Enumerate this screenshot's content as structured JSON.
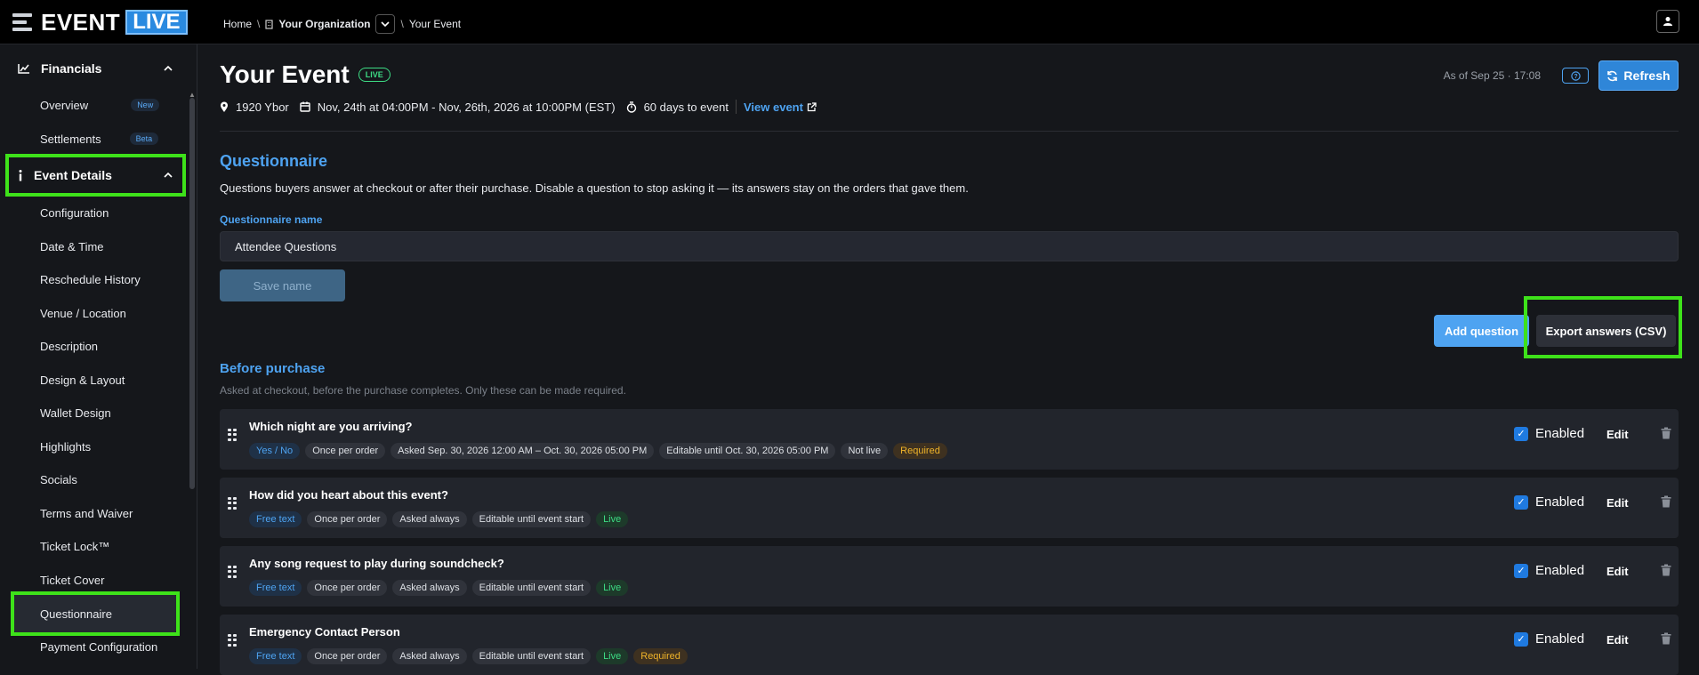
{
  "brand": {
    "word": "EVENT",
    "live": "LIVE"
  },
  "breadcrumb": {
    "home": "Home",
    "org": "Your Organization",
    "event": "Your Event"
  },
  "sidebar": {
    "financials": "Financials",
    "overview": "Overview",
    "overview_badge": "New",
    "settlements": "Settlements",
    "settlements_badge": "Beta",
    "event_details": "Event Details",
    "items": [
      "Configuration",
      "Date & Time",
      "Reschedule History",
      "Venue / Location",
      "Description",
      "Design & Layout",
      "Wallet Design",
      "Highlights",
      "Socials",
      "Terms and Waiver",
      "Ticket Lock™",
      "Ticket Cover",
      "Questionnaire",
      "Payment Configuration"
    ]
  },
  "header": {
    "title": "Your Event",
    "status": "LIVE",
    "venue": "1920 Ybor",
    "dates": "Nov, 24th at 04:00PM - Nov, 26th, 2026 at 10:00PM (EST)",
    "countdown": "60 days to event",
    "view_event": "View event",
    "as_of": "As of Sep 25 · 17:08",
    "refresh": "Refresh"
  },
  "questionnaire": {
    "title": "Questionnaire",
    "description": "Questions buyers answer at checkout or after their purchase. Disable a question to stop asking it — its answers stay on the orders that gave them.",
    "name_label": "Questionnaire name",
    "name_value": "Attendee Questions",
    "save_name": "Save name",
    "add_question": "Add question",
    "export": "Export answers (CSV)",
    "before_title": "Before purchase",
    "before_desc": "Asked at checkout, before the purchase completes. Only these can be made required.",
    "enabled_label": "Enabled",
    "edit_label": "Edit",
    "questions": [
      {
        "title": "Which night are you arriving?",
        "type": "Yes / No",
        "freq": "Once per order",
        "asked": "Asked Sep. 30, 2026 12:00 AM – Oct. 30, 2026 05:00 PM",
        "editable": "Editable until Oct. 30, 2026 05:00 PM",
        "status": "Not live",
        "required": "Required"
      },
      {
        "title": "How did you heart about this event?",
        "type": "Free text",
        "freq": "Once per order",
        "asked": "Asked always",
        "editable": "Editable until event start",
        "status": "Live",
        "required": ""
      },
      {
        "title": "Any song request to play during soundcheck?",
        "type": "Free text",
        "freq": "Once per order",
        "asked": "Asked always",
        "editable": "Editable until event start",
        "status": "Live",
        "required": ""
      },
      {
        "title": "Emergency Contact Person",
        "type": "Free text",
        "freq": "Once per order",
        "asked": "Asked always",
        "editable": "Editable until event start",
        "status": "Live",
        "required": "Required"
      }
    ]
  }
}
